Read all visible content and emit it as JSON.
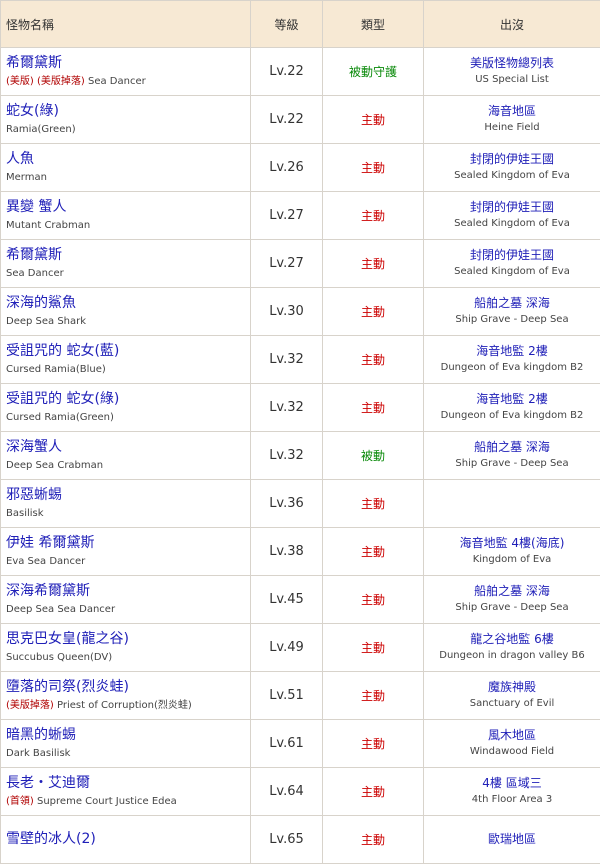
{
  "headers": {
    "name": "怪物名稱",
    "level": "等級",
    "type": "類型",
    "location": "出沒"
  },
  "rows": [
    {
      "name_zh": "希爾黛斯",
      "tags": [
        "(美版)",
        "(美版掉落)"
      ],
      "name_en": "Sea Dancer",
      "level": "Lv.22",
      "type": "被動守護",
      "type_kind": "passive",
      "loc_zh": "美版怪物總列表",
      "loc_en": "US Special List"
    },
    {
      "name_zh": "蛇女(綠)",
      "tags": [],
      "name_en": "Ramia(Green)",
      "level": "Lv.22",
      "type": "主動",
      "type_kind": "active",
      "loc_zh": "海音地區",
      "loc_en": "Heine Field"
    },
    {
      "name_zh": "人魚",
      "tags": [],
      "name_en": "Merman",
      "level": "Lv.26",
      "type": "主動",
      "type_kind": "active",
      "loc_zh": "封閉的伊娃王國",
      "loc_en": "Sealed Kingdom of Eva"
    },
    {
      "name_zh": "異變 蟹人",
      "tags": [],
      "name_en": "Mutant Crabman",
      "level": "Lv.27",
      "type": "主動",
      "type_kind": "active",
      "loc_zh": "封閉的伊娃王國",
      "loc_en": "Sealed Kingdom of Eva"
    },
    {
      "name_zh": "希爾黛斯",
      "tags": [],
      "name_en": "Sea Dancer",
      "level": "Lv.27",
      "type": "主動",
      "type_kind": "active",
      "loc_zh": "封閉的伊娃王國",
      "loc_en": "Sealed Kingdom of Eva"
    },
    {
      "name_zh": "深海的鯊魚",
      "tags": [],
      "name_en": "Deep Sea Shark",
      "level": "Lv.30",
      "type": "主動",
      "type_kind": "active",
      "loc_zh": "船舶之墓 深海",
      "loc_en": "Ship Grave - Deep Sea"
    },
    {
      "name_zh": "受詛咒的 蛇女(藍)",
      "tags": [],
      "name_en": "Cursed Ramia(Blue)",
      "level": "Lv.32",
      "type": "主動",
      "type_kind": "active",
      "loc_zh": "海音地監 2樓",
      "loc_en": "Dungeon of Eva kingdom B2"
    },
    {
      "name_zh": "受詛咒的 蛇女(綠)",
      "tags": [],
      "name_en": "Cursed Ramia(Green)",
      "level": "Lv.32",
      "type": "主動",
      "type_kind": "active",
      "loc_zh": "海音地監 2樓",
      "loc_en": "Dungeon of Eva kingdom B2"
    },
    {
      "name_zh": "深海蟹人",
      "tags": [],
      "name_en": "Deep Sea Crabman",
      "level": "Lv.32",
      "type": "被動",
      "type_kind": "passive",
      "loc_zh": "船舶之墓 深海",
      "loc_en": "Ship Grave - Deep Sea"
    },
    {
      "name_zh": "邪惡蜥蜴",
      "tags": [],
      "name_en": "Basilisk",
      "level": "Lv.36",
      "type": "主動",
      "type_kind": "active",
      "loc_zh": "",
      "loc_en": ""
    },
    {
      "name_zh": "伊娃 希爾黛斯",
      "tags": [],
      "name_en": "Eva Sea Dancer",
      "level": "Lv.38",
      "type": "主動",
      "type_kind": "active",
      "loc_zh": "海音地監 4樓(海底)",
      "loc_en": "Kingdom of Eva"
    },
    {
      "name_zh": "深海希爾黛斯",
      "tags": [],
      "name_en": "Deep Sea Sea Dancer",
      "level": "Lv.45",
      "type": "主動",
      "type_kind": "active",
      "loc_zh": "船舶之墓 深海",
      "loc_en": "Ship Grave - Deep Sea"
    },
    {
      "name_zh": "思克巴女皇(龍之谷)",
      "tags": [],
      "name_en": "Succubus Queen(DV)",
      "level": "Lv.49",
      "type": "主動",
      "type_kind": "active",
      "loc_zh": "龍之谷地監 6樓",
      "loc_en": "Dungeon in dragon valley B6"
    },
    {
      "name_zh": "墮落的司祭(烈炎蛙)",
      "tags": [
        "(美版掉落)"
      ],
      "name_en": "Priest of Corruption(烈炎蛙)",
      "level": "Lv.51",
      "type": "主動",
      "type_kind": "active",
      "loc_zh": "魔族神殿",
      "loc_en": "Sanctuary of Evil"
    },
    {
      "name_zh": "暗黑的蜥蜴",
      "tags": [],
      "name_en": "Dark Basilisk",
      "level": "Lv.61",
      "type": "主動",
      "type_kind": "active",
      "loc_zh": "風木地區",
      "loc_en": "Windawood Field"
    },
    {
      "name_zh": "長老・艾迪爾",
      "tags": [
        "(首領)"
      ],
      "name_en": "Supreme Court Justice Edea",
      "level": "Lv.64",
      "type": "主動",
      "type_kind": "active",
      "loc_zh": "4樓 區域三",
      "loc_en": "4th Floor Area 3"
    },
    {
      "name_zh": "雪壁的冰人(2)",
      "tags": [],
      "name_en": "",
      "level": "Lv.65",
      "type": "主動",
      "type_kind": "active",
      "loc_zh": "歐瑞地區",
      "loc_en": ""
    }
  ]
}
